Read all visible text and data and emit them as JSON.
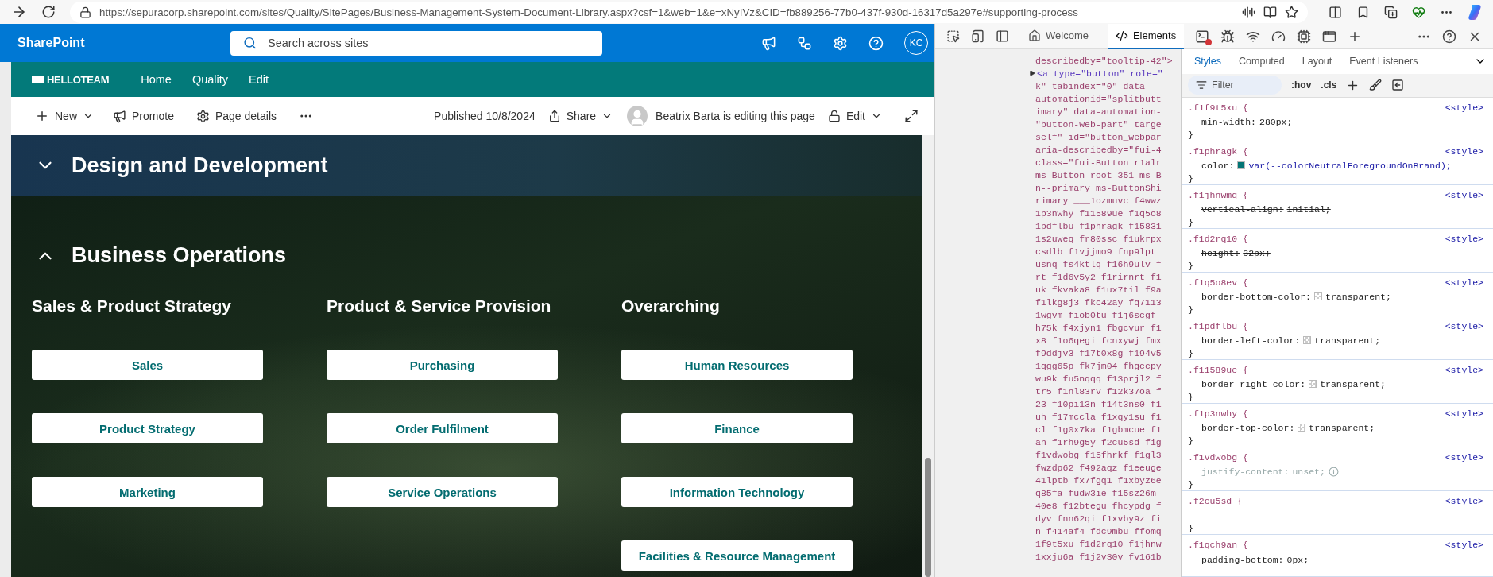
{
  "browser": {
    "url": "https://sepuracorp.sharepoint.com/sites/Quality/SitePages/Business-Management-System-Document-Library.aspx?csf=1&web=1&e=xNyIVz&CID=fb889256-77b0-437f-930d-16317d5a297e#supporting-process"
  },
  "suite_bar": {
    "app_name": "SharePoint",
    "search": {
      "placeholder": "Search across sites"
    },
    "avatar": "KC"
  },
  "hub_nav": {
    "logo": "HELLOTEAM",
    "items": [
      "Home",
      "Quality",
      "Edit"
    ]
  },
  "command_bar": {
    "new": "New",
    "promote": "Promote",
    "page_details": "Page details",
    "published": "Published 10/8/2024",
    "share": "Share",
    "editing": "Beatrix Barta is editing this page",
    "edit": "Edit"
  },
  "sections": [
    {
      "title": "Design and Development",
      "expanded": false
    },
    {
      "title": "Business Operations",
      "expanded": true,
      "columns": [
        {
          "heading": "Sales & Product Strategy",
          "links": [
            "Sales",
            "Product Strategy",
            "Marketing"
          ]
        },
        {
          "heading": "Product & Service Provision",
          "links": [
            "Purchasing",
            "Order Fulfilment",
            "Service Operations"
          ]
        },
        {
          "heading": "Overarching",
          "links": [
            "Human Resources",
            "Finance",
            "Information Technology",
            "Facilities & Resource Management"
          ]
        }
      ]
    }
  ],
  "devtools": {
    "tabs": [
      {
        "label": "Welcome",
        "selected": false
      },
      {
        "label": "Elements",
        "selected": true
      }
    ],
    "elements": [
      {
        "kind": "attr",
        "text": "describedby=\"tooltip-42\">"
      },
      {
        "kind": "tag",
        "text": "<a type=\"button\" role=\""
      },
      {
        "kind": "attr",
        "text": "k\" tabindex=\"0\" data-"
      },
      {
        "kind": "attr",
        "text": "automationid=\"splitbutt"
      },
      {
        "kind": "attr",
        "text": "imary\" data-automation-"
      },
      {
        "kind": "attr",
        "text": "\"button-web-part\" targe"
      },
      {
        "kind": "attr",
        "text": "self\" id=\"button_webpar"
      },
      {
        "kind": "attr",
        "text": "aria-describedby=\"fui-4"
      },
      {
        "kind": "attr",
        "text": "class=\"fui-Button r1alr"
      },
      {
        "kind": "attr",
        "text": "ms-Button root-351 ms-B"
      },
      {
        "kind": "attr",
        "text": "n--primary ms-ButtonShi"
      },
      {
        "kind": "attr",
        "text": "rimary ___1ozmuvc f4wwz"
      },
      {
        "kind": "attr",
        "text": "1p3nwhy f11589ue f1q5o8"
      },
      {
        "kind": "attr",
        "text": "1pdflbu f1phragk f15831"
      },
      {
        "kind": "attr",
        "text": "1s2uweq fr80ssc f1ukrpx"
      },
      {
        "kind": "attr",
        "text": "csdlb f1vjjmo9 fnp9lpt"
      },
      {
        "kind": "attr",
        "text": "usnq fs4ktlq f16h9ulv f"
      },
      {
        "kind": "attr",
        "text": "rt f1d6v5y2 f1rirnrt f1"
      },
      {
        "kind": "attr",
        "text": "uk fkvaka8 f1ux7til f9a"
      },
      {
        "kind": "attr",
        "text": "f1lkg8j3 fkc42ay fq7113"
      },
      {
        "kind": "attr",
        "text": "1wgvm fiob0tu f1j6scgf"
      },
      {
        "kind": "attr",
        "text": "h75k f4xjyn1 fbgcvur f1"
      },
      {
        "kind": "attr",
        "text": "x8 f1o6qegi fcnxywj fmx"
      },
      {
        "kind": "attr",
        "text": "f9ddjv3 f17t0x8g f194v5"
      },
      {
        "kind": "attr",
        "text": "1qgg65p fk7jm04 fhgccpy"
      },
      {
        "kind": "attr",
        "text": "wu9k fu5nqqq f13prjl2 f"
      },
      {
        "kind": "attr",
        "text": "tr5 f1nl83rv f12k37oa f"
      },
      {
        "kind": "attr",
        "text": "23 f10pi13n f14t3ns0 f1"
      },
      {
        "kind": "attr",
        "text": "uh f17mccla f1xqy1su f1"
      },
      {
        "kind": "attr",
        "text": "cl f1g0x7ka f1gbmcue f1"
      },
      {
        "kind": "attr",
        "text": "an f1rh9g5y f2cu5sd fig"
      },
      {
        "kind": "attr",
        "text": "f1vdwobg f15fhrkf f1gl3"
      },
      {
        "kind": "attr",
        "text": "fwzdp62 f492aqz f1eeuge"
      },
      {
        "kind": "attr",
        "text": "41lptb fx7fgq1 f1xbyz6e"
      },
      {
        "kind": "attr",
        "text": "q85fa fudw3ie f15sz26m"
      },
      {
        "kind": "attr",
        "text": "40e8 f12btegu fhcypdg f"
      },
      {
        "kind": "attr",
        "text": "dyv fnn62qi f1xvby9z fi"
      },
      {
        "kind": "attr",
        "text": "n f414af4 fdc9mbu ffomq"
      },
      {
        "kind": "attr",
        "text": "1f9t5xu f1d2rq10 f1jhnw"
      },
      {
        "kind": "attr",
        "text": "1xxju6a f1j2v30v fv161b"
      }
    ],
    "style_tabs": [
      {
        "label": "Styles",
        "selected": true
      },
      {
        "label": "Computed",
        "selected": false
      },
      {
        "label": "Layout",
        "selected": false
      },
      {
        "label": "Event Listeners",
        "selected": false
      }
    ],
    "filter": {
      "placeholder": "Filter"
    },
    "hov": ":hov",
    "cls": ".cls",
    "rules": [
      {
        "selector": ".f1f9t5xu {",
        "source": "<style>",
        "property": "min-width:",
        "value": "280px;",
        "struck": false,
        "inactive": false,
        "close": "}"
      },
      {
        "selector": ".f1phragk {",
        "source": "<style>",
        "property": "color:",
        "kind": "brand_color",
        "value": "var(--colorNeutralForegroundOnBrand);",
        "struck": false,
        "inactive": false,
        "close": "}"
      },
      {
        "selector": ".f1jhnwmq {",
        "source": "<style>",
        "property": "vertical-align:",
        "value": "initial;",
        "struck": true,
        "inactive": false,
        "close": "}"
      },
      {
        "selector": ".f1d2rq10 {",
        "source": "<style>",
        "property": "height:",
        "value": "32px;",
        "struck": true,
        "inactive": false,
        "close": "}"
      },
      {
        "selector": ".f1q5o8ev {",
        "source": "<style>",
        "property": "border-bottom-color:",
        "kind": "transparent_color",
        "value": "transparent;",
        "struck": false,
        "inactive": false,
        "close": "}"
      },
      {
        "selector": ".f1pdflbu {",
        "source": "<style>",
        "property": "border-left-color:",
        "kind": "transparent_color",
        "value": "transparent;",
        "struck": false,
        "inactive": false,
        "close": "}"
      },
      {
        "selector": ".f11589ue {",
        "source": "<style>",
        "property": "border-right-color:",
        "kind": "transparent_color",
        "value": "transparent;",
        "struck": false,
        "inactive": false,
        "close": "}"
      },
      {
        "selector": ".f1p3nwhy {",
        "source": "<style>",
        "property": "border-top-color:",
        "kind": "transparent_color",
        "value": "transparent;",
        "struck": false,
        "inactive": false,
        "close": "}"
      },
      {
        "selector": ".f1vdwobg {",
        "source": "<style>",
        "property": "justify-content:",
        "value": "unset;",
        "struck": false,
        "inactive": true,
        "close": "}"
      },
      {
        "selector": ".f2cu5sd {",
        "source": "<style>",
        "close": "}"
      },
      {
        "selector": ".f1qch9an {",
        "source": "<style>",
        "property": "padding-bottom:",
        "value": "0px;",
        "struck": true,
        "inactive": false
      }
    ]
  }
}
